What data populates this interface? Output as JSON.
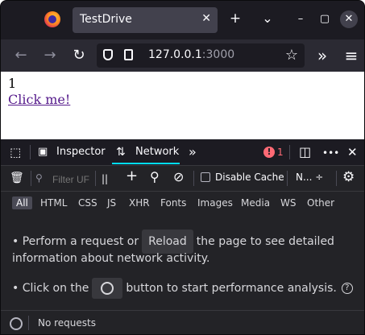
{
  "tab": {
    "title": "TestDrive",
    "close": "✕"
  },
  "tabbar": {
    "new_tab": "+",
    "list_tabs": "⌄",
    "minimize": "–",
    "maximize": "▢",
    "close": "✕"
  },
  "nav": {
    "back": "←",
    "forward": "→",
    "reload": "↻",
    "url_host": "127.0.0.1",
    "url_port": ":3000",
    "bookmark": "☆",
    "overflow": "»",
    "menu": "≡"
  },
  "page": {
    "count": "1",
    "link": "Click me!"
  },
  "devtools": {
    "picker": "⬚",
    "tab_inspector": "Inspector",
    "tab_network": "Network",
    "more_tabs": "»",
    "error_icon": "!",
    "error_count": "1",
    "dock": "◫",
    "options": "•••",
    "close": "✕"
  },
  "network_toolbar": {
    "trash": "🗑",
    "filter_placeholder": "Filter UF",
    "pause": "||",
    "add": "+",
    "search": "⚲",
    "block": "⊘",
    "disable_cache": "Disable Cache",
    "throttle": "N... ÷",
    "settings": "⚙"
  },
  "type_filters": [
    "All",
    "HTML",
    "CSS",
    "JS",
    "XHR",
    "Fonts",
    "Images",
    "Media",
    "WS",
    "Other"
  ],
  "panel": {
    "line1_a": "• Perform a request or",
    "reload_button": "Reload",
    "line1_b": "the page to see detailed",
    "line2": "information about network activity.",
    "line3_a": "• Click on the",
    "line3_b": "button to start performance analysis.",
    "help": "?"
  },
  "status": {
    "text": "No requests"
  },
  "colors": {
    "accent": "#00ddff",
    "error": "#ff6a75",
    "link": "#551a8b"
  }
}
